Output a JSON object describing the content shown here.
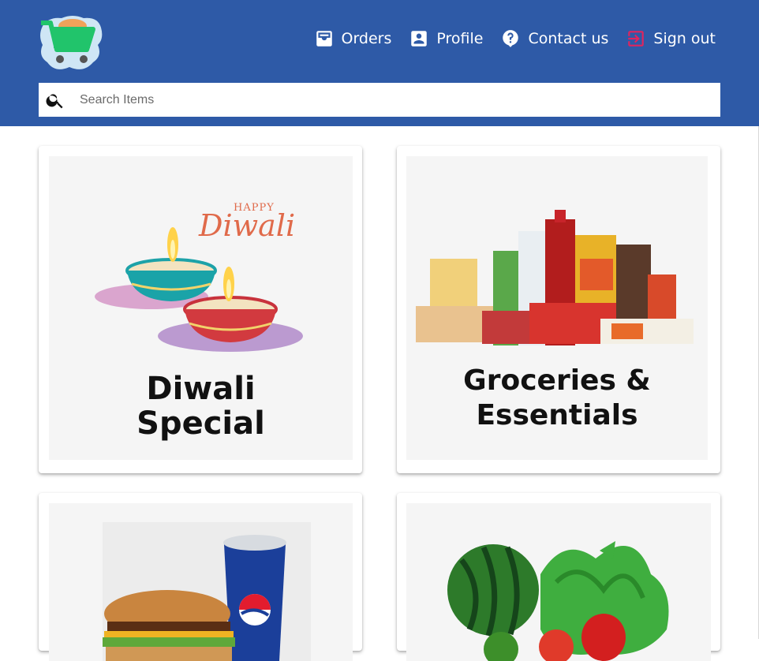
{
  "header": {
    "background": "#2e5aa7",
    "logo_icon": "shopping-cart-logo-icon",
    "nav": [
      {
        "label": "Orders",
        "icon": "inbox-tray-icon"
      },
      {
        "label": "Profile",
        "icon": "account-box-icon"
      },
      {
        "label": "Contact us",
        "icon": "help-bubble-icon"
      },
      {
        "label": "Sign out",
        "icon": "exit-to-app-icon"
      }
    ]
  },
  "search": {
    "placeholder": "Search Items",
    "value": "",
    "icon": "search-icon"
  },
  "categories": [
    {
      "caption_line1": "Diwali",
      "caption_line2": "Special",
      "overlay_title_small": "HAPPY",
      "overlay_title_large": "Diwali"
    },
    {
      "caption_line1": "Groceries &",
      "caption_line2": "Essentials"
    },
    {
      "caption_line1": "",
      "caption_line2": ""
    },
    {
      "caption_line1": "",
      "caption_line2": ""
    }
  ],
  "colors": {
    "accent": "#2e5aa7",
    "signout_icon": "#e0245e",
    "logo_cart": "#21c46b"
  }
}
